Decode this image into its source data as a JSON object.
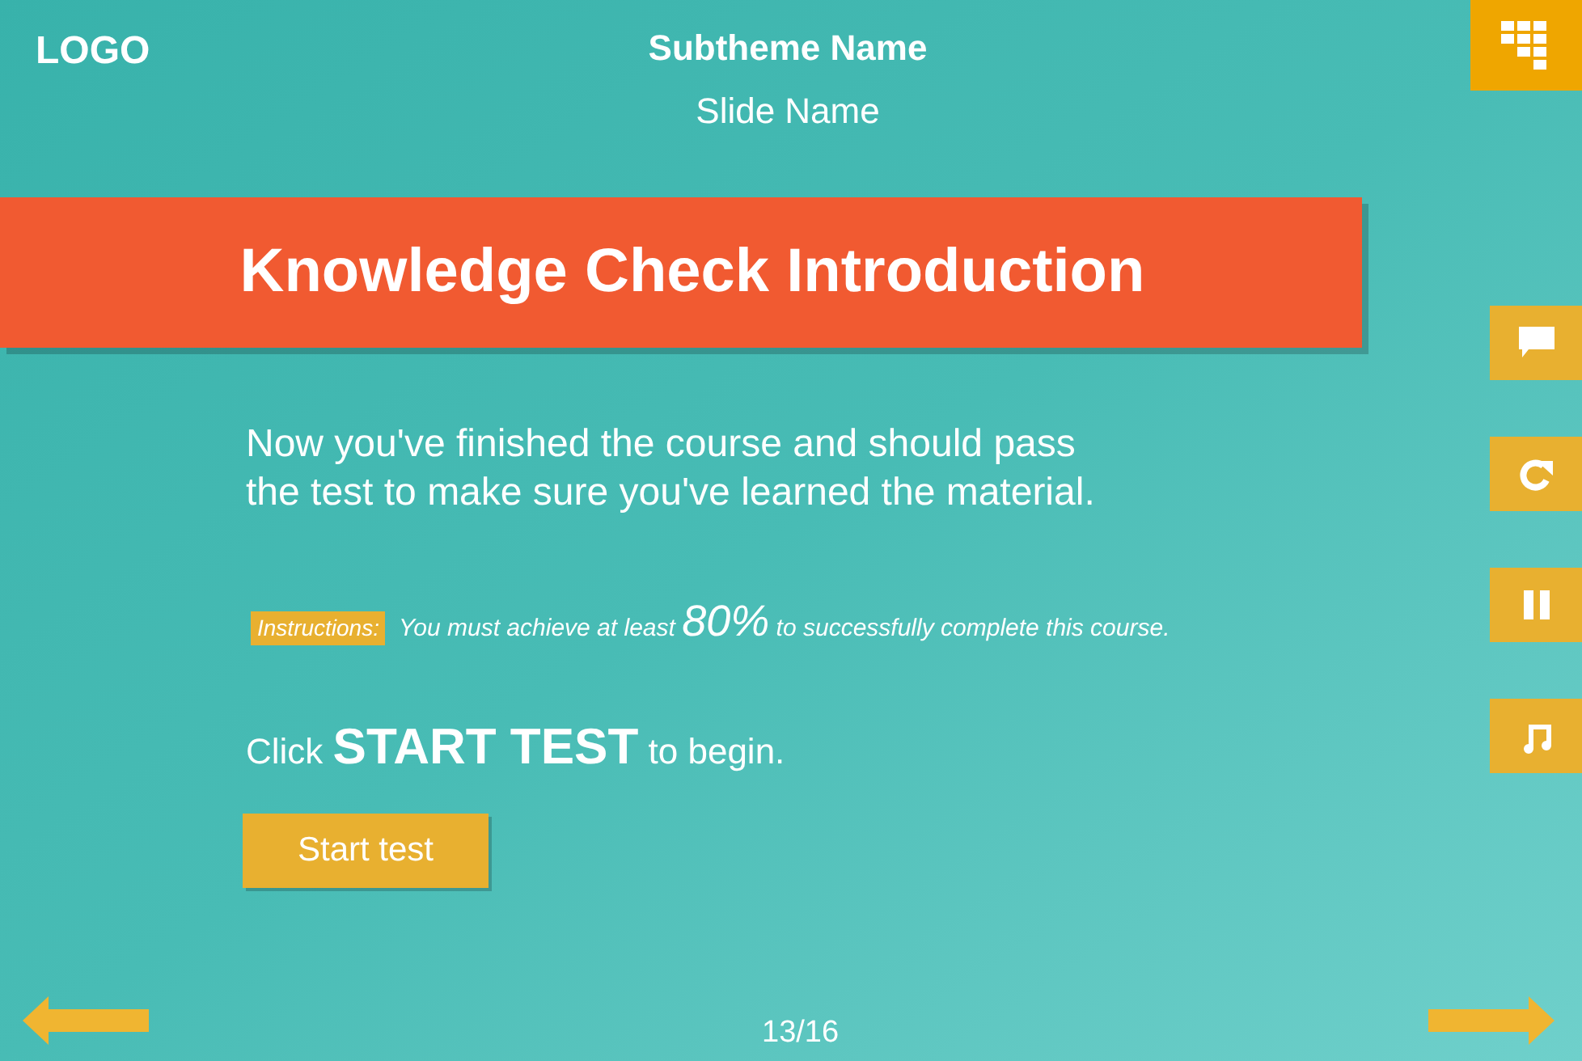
{
  "header": {
    "logo": "LOGO",
    "subtheme": "Subtheme Name",
    "slide": "Slide Name"
  },
  "title": "Knowledge Check Introduction",
  "intro": "Now you've finished the course and should pass the test to make sure you've learned the material.",
  "instructions": {
    "label": "Instructions:",
    "before": "You must achieve at least",
    "highlight": "80%",
    "after": "to successfully complete this course."
  },
  "start_prompt": {
    "before": "Click",
    "emphasis": "START TEST",
    "after": "to begin."
  },
  "start_button": "Start test",
  "side_buttons": [
    {
      "kind": "comment"
    },
    {
      "kind": "replay"
    },
    {
      "kind": "pause"
    },
    {
      "kind": "audio"
    }
  ],
  "page": "13/16"
}
